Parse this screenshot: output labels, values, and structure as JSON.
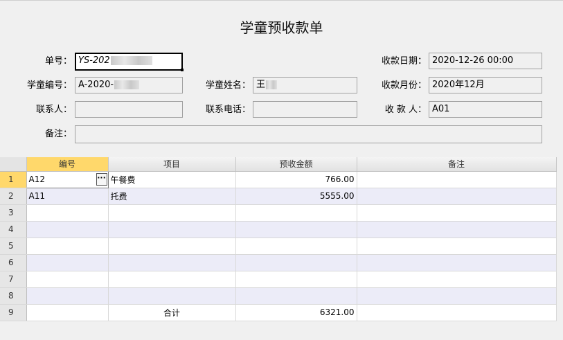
{
  "title": "学童预收款单",
  "header": {
    "order_no": {
      "label": "单号：",
      "value": "YS-202"
    },
    "receipt_date": {
      "label": "收款日期：",
      "value": "2020-12-26 00:00"
    },
    "student_no": {
      "label": "学童编号：",
      "value": "A-2020-"
    },
    "student_name": {
      "label": "学童姓名：",
      "value": "王"
    },
    "receipt_month": {
      "label": "收款月份：",
      "value": "2020年12月"
    },
    "contact": {
      "label": "联系人：",
      "value": ""
    },
    "phone": {
      "label": "联系电话：",
      "value": ""
    },
    "receiver": {
      "label": "收 款 人：",
      "value": "A01"
    },
    "remark": {
      "label": "备注：",
      "value": ""
    }
  },
  "grid": {
    "columns": [
      "编号",
      "项目",
      "预收金额",
      "备注"
    ],
    "rows": [
      {
        "n": "1",
        "code": "A12",
        "item": "午餐费",
        "amount": "766.00",
        "remark": ""
      },
      {
        "n": "2",
        "code": "A11",
        "item": "托费",
        "amount": "5555.00",
        "remark": ""
      },
      {
        "n": "3",
        "code": "",
        "item": "",
        "amount": "",
        "remark": ""
      },
      {
        "n": "4",
        "code": "",
        "item": "",
        "amount": "",
        "remark": ""
      },
      {
        "n": "5",
        "code": "",
        "item": "",
        "amount": "",
        "remark": ""
      },
      {
        "n": "6",
        "code": "",
        "item": "",
        "amount": "",
        "remark": ""
      },
      {
        "n": "7",
        "code": "",
        "item": "",
        "amount": "",
        "remark": ""
      },
      {
        "n": "8",
        "code": "",
        "item": "",
        "amount": "",
        "remark": ""
      }
    ],
    "total": {
      "n": "9",
      "label": "合计",
      "amount": "6321.00"
    },
    "ellipsis": "···"
  }
}
